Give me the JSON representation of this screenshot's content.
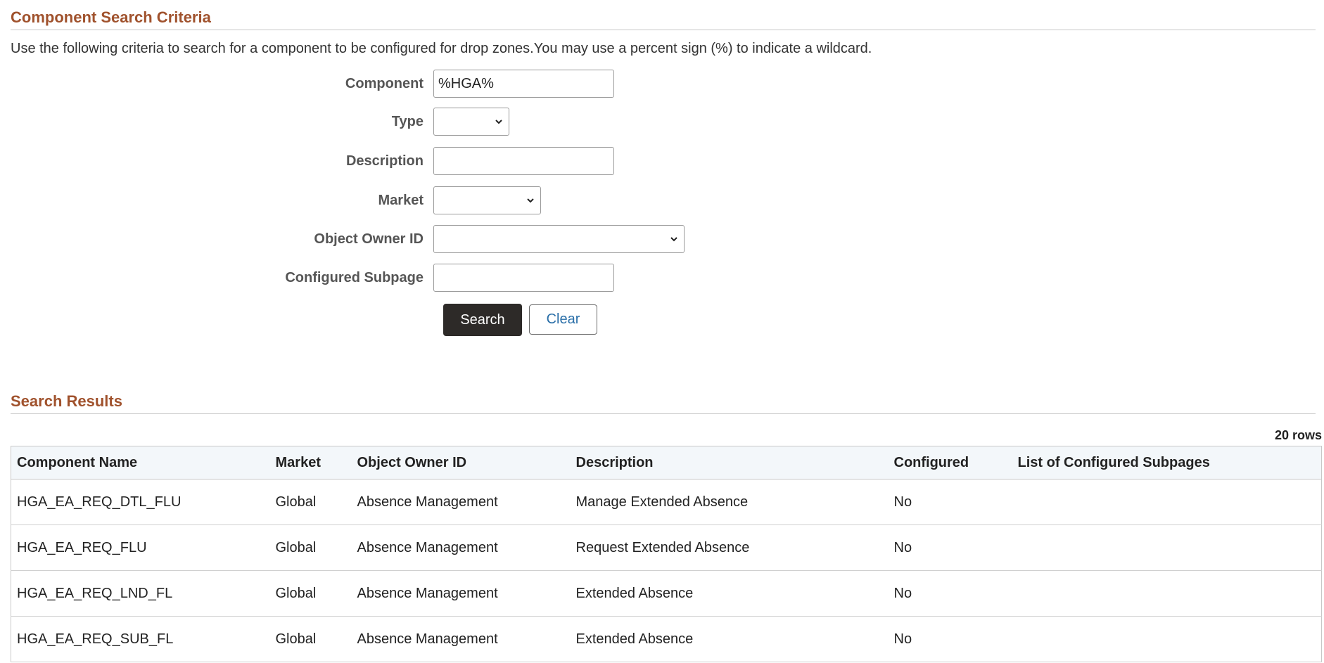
{
  "criteria": {
    "title": "Component Search Criteria",
    "instructions": "Use the following criteria to search for a component to be configured for drop zones.You may use a percent sign (%) to indicate a wildcard.",
    "fields": {
      "component": {
        "label": "Component",
        "value": "%HGA%"
      },
      "type": {
        "label": "Type",
        "value": ""
      },
      "description": {
        "label": "Description",
        "value": ""
      },
      "market": {
        "label": "Market",
        "value": ""
      },
      "owner": {
        "label": "Object Owner ID",
        "value": ""
      },
      "subpage": {
        "label": "Configured Subpage",
        "value": ""
      }
    },
    "buttons": {
      "search": "Search",
      "clear": "Clear"
    }
  },
  "results": {
    "title": "Search Results",
    "row_count": "20 rows",
    "columns": [
      "Component Name",
      "Market",
      "Object Owner ID",
      "Description",
      "Configured",
      "List of Configured Subpages"
    ],
    "rows": [
      [
        "HGA_EA_REQ_DTL_FLU",
        "Global",
        "Absence Management",
        "Manage Extended Absence",
        "No",
        ""
      ],
      [
        "HGA_EA_REQ_FLU",
        "Global",
        "Absence Management",
        "Request Extended Absence",
        "No",
        ""
      ],
      [
        "HGA_EA_REQ_LND_FL",
        "Global",
        "Absence Management",
        "Extended Absence",
        "No",
        ""
      ],
      [
        "HGA_EA_REQ_SUB_FL",
        "Global",
        "Absence Management",
        "Extended Absence",
        "No",
        ""
      ]
    ]
  },
  "colors": {
    "section_header": "#a0522d",
    "primary_button": "#2d2a28",
    "link": "#2a6fa8"
  }
}
